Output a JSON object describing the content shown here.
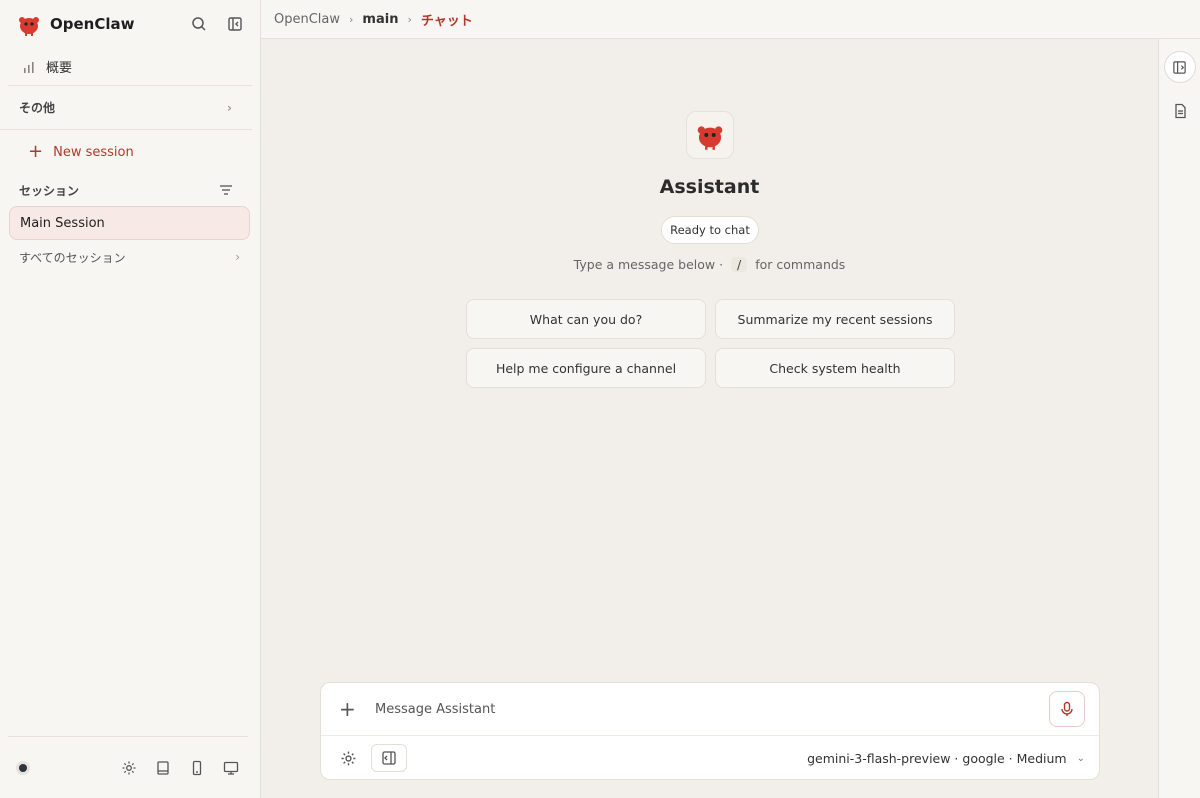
{
  "brand": {
    "name": "OpenClaw"
  },
  "sidebar": {
    "overview_label": "概要",
    "group_label": "その他",
    "new_session_label": "New session",
    "sessions_heading": "セッション",
    "active_session": "Main Session",
    "all_sessions_label": "すべてのセッション"
  },
  "breadcrumb": {
    "root": "OpenClaw",
    "middle": "main",
    "current": "チャット"
  },
  "chat": {
    "assistant_name": "Assistant",
    "status": "Ready to chat",
    "hint_prefix": "Type a message below ·",
    "hint_key": "/",
    "hint_suffix": "for commands",
    "suggestions": [
      "What can you do?",
      "Summarize my recent sessions",
      "Help me configure a channel",
      "Check system health"
    ]
  },
  "composer": {
    "placeholder": "Message Assistant",
    "model_label": "gemini-3-flash-preview · google · Medium"
  },
  "colors": {
    "accent": "#b3362c",
    "background": "#f2efea",
    "sidebar": "#f8f6f3"
  },
  "icons": [
    "openclaw-logo-icon",
    "search-icon",
    "sidebar-collapse-icon",
    "chart-icon",
    "chevron-right-icon",
    "plus-icon",
    "filter-icon",
    "status-dot-icon",
    "settings-icon",
    "book-icon",
    "mobile-icon",
    "desktop-icon",
    "panel-toggle-icon",
    "document-icon",
    "microphone-icon",
    "gear-icon",
    "chevron-down-icon"
  ]
}
